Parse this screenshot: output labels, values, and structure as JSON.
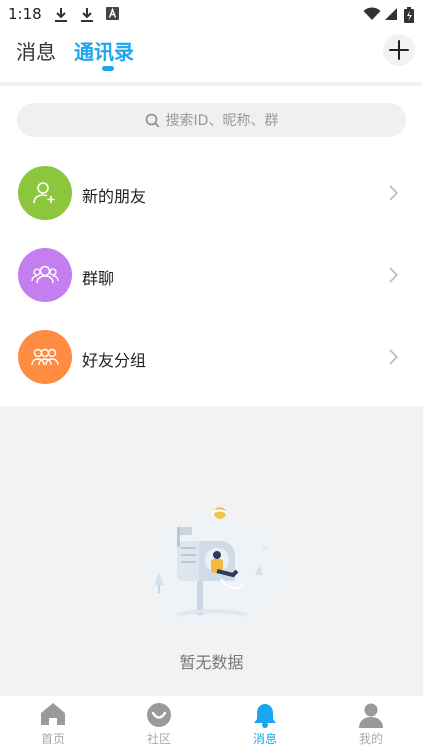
{
  "status_bar": {
    "time": "1:18"
  },
  "header": {
    "tabs": [
      {
        "label": "消息",
        "active": false
      },
      {
        "label": "通讯录",
        "active": true
      }
    ],
    "add_icon": "plus-icon"
  },
  "search": {
    "placeholder": "搜索ID、昵称、群",
    "icon": "search-icon"
  },
  "contact_entries": [
    {
      "label": "新的朋友",
      "icon": "add-person-icon",
      "color": "#8cc63f"
    },
    {
      "label": "群聊",
      "icon": "group-icon",
      "color": "#c47ef0"
    },
    {
      "label": "好友分组",
      "icon": "multi-group-icon",
      "color": "#ff8c42"
    }
  ],
  "empty_state": {
    "text": "暂无数据",
    "illustration": "empty-mailbox-illustration"
  },
  "bottom_nav": {
    "items": [
      {
        "label": "首页",
        "icon": "home-icon",
        "active": false
      },
      {
        "label": "社区",
        "icon": "community-icon",
        "active": false
      },
      {
        "label": "消息",
        "icon": "bell-icon",
        "active": true
      },
      {
        "label": "我的",
        "icon": "person-icon",
        "active": false
      }
    ]
  },
  "colors": {
    "accent": "#1aa6f0",
    "background": "#f2f2f2",
    "inactive": "#aaaaaa"
  }
}
